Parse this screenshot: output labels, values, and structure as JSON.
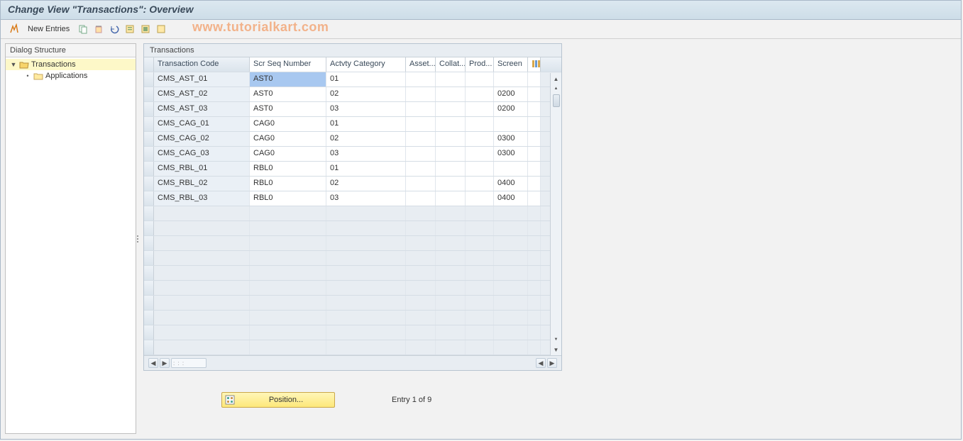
{
  "title": "Change View \"Transactions\": Overview",
  "toolbar": {
    "new_entries": "New Entries"
  },
  "watermark": "www.tutorialkart.com",
  "sidebar": {
    "header": "Dialog Structure",
    "items": [
      {
        "label": "Transactions",
        "selected": true,
        "level": 0,
        "open": true,
        "folder": "open"
      },
      {
        "label": "Applications",
        "selected": false,
        "level": 1,
        "open": false,
        "folder": "closed"
      }
    ]
  },
  "panel": {
    "title": "Transactions",
    "columns": {
      "txcode": "Transaction Code",
      "seq": "Scr Seq Number",
      "act": "Actvty Category",
      "asset": "Asset...",
      "collat": "Collat...",
      "prod": "Prod...",
      "screen": "Screen"
    },
    "rows": [
      {
        "txcode": "CMS_AST_01",
        "seq": "AST0",
        "act": "01",
        "asset": "",
        "collat": "",
        "prod": "",
        "screen": "",
        "sel": true
      },
      {
        "txcode": "CMS_AST_02",
        "seq": "AST0",
        "act": "02",
        "asset": "",
        "collat": "",
        "prod": "",
        "screen": "0200"
      },
      {
        "txcode": "CMS_AST_03",
        "seq": "AST0",
        "act": "03",
        "asset": "",
        "collat": "",
        "prod": "",
        "screen": "0200"
      },
      {
        "txcode": "CMS_CAG_01",
        "seq": "CAG0",
        "act": "01",
        "asset": "",
        "collat": "",
        "prod": "",
        "screen": ""
      },
      {
        "txcode": "CMS_CAG_02",
        "seq": "CAG0",
        "act": "02",
        "asset": "",
        "collat": "",
        "prod": "",
        "screen": "0300"
      },
      {
        "txcode": "CMS_CAG_03",
        "seq": "CAG0",
        "act": "03",
        "asset": "",
        "collat": "",
        "prod": "",
        "screen": "0300"
      },
      {
        "txcode": "CMS_RBL_01",
        "seq": "RBL0",
        "act": "01",
        "asset": "",
        "collat": "",
        "prod": "",
        "screen": ""
      },
      {
        "txcode": "CMS_RBL_02",
        "seq": "RBL0",
        "act": "02",
        "asset": "",
        "collat": "",
        "prod": "",
        "screen": "0400"
      },
      {
        "txcode": "CMS_RBL_03",
        "seq": "RBL0",
        "act": "03",
        "asset": "",
        "collat": "",
        "prod": "",
        "screen": "0400"
      }
    ],
    "empty_rows": 10
  },
  "footer": {
    "position_label": "Position...",
    "entry_text": "Entry 1 of 9"
  }
}
